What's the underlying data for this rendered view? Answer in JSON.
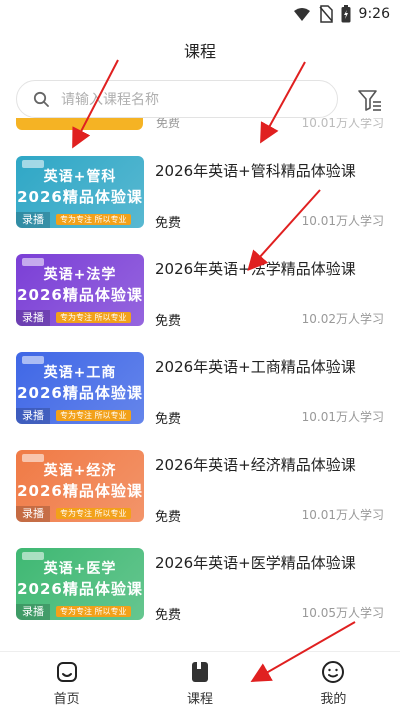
{
  "status_bar": {
    "time": "9:26",
    "icons": [
      "wifi-icon",
      "no-sim-icon",
      "battery-icon"
    ]
  },
  "header": {
    "title": "课程"
  },
  "search": {
    "placeholder": "请输入课程名称",
    "value": ""
  },
  "partial_top": {
    "price": "免费",
    "count": "10.01万人学习"
  },
  "courses": [
    {
      "title": "2026年英语+管科精品体验课",
      "price": "免费",
      "count": "10.01万人学习",
      "thumb_line1": "英语+管科",
      "thumb_line2": "2026精品体验课",
      "thumb_tag": "录播",
      "thumb_slogan": "专为专注 所以专业",
      "color": "#2fa7c6"
    },
    {
      "title": "2026年英语+法学精品体验课",
      "price": "免费",
      "count": "10.02万人学习",
      "thumb_line1": "英语+法学",
      "thumb_line2": "2026精品体验课",
      "thumb_tag": "录播",
      "thumb_slogan": "专为专注 所以专业",
      "color": "#7b3fd6"
    },
    {
      "title": "2026年英语+工商精品体验课",
      "price": "免费",
      "count": "10.01万人学习",
      "thumb_line1": "英语+工商",
      "thumb_line2": "2026精品体验课",
      "thumb_tag": "录播",
      "thumb_slogan": "专为专注 所以专业",
      "color": "#3f67e6"
    },
    {
      "title": "2026年英语+经济精品体验课",
      "price": "免费",
      "count": "10.01万人学习",
      "thumb_line1": "英语+经济",
      "thumb_line2": "2026精品体验课",
      "thumb_tag": "录播",
      "thumb_slogan": "专为专注 所以专业",
      "color": "#f07a45"
    },
    {
      "title": "2026年英语+医学精品体验课",
      "price": "免费",
      "count": "10.05万人学习",
      "thumb_line1": "英语+医学",
      "thumb_line2": "2026精品体验课",
      "thumb_tag": "录播",
      "thumb_slogan": "专为专注 所以专业",
      "color": "#3fb873"
    }
  ],
  "tab_bar": {
    "tabs": [
      {
        "label": "首页",
        "icon": "home-icon"
      },
      {
        "label": "课程",
        "icon": "course-icon"
      },
      {
        "label": "我的",
        "icon": "profile-icon"
      }
    ]
  },
  "annotation": {
    "arrow_color": "#e02020"
  }
}
